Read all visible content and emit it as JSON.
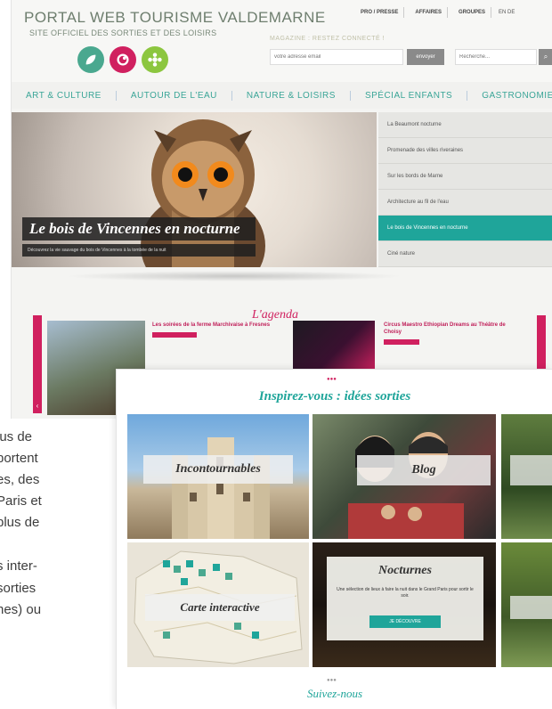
{
  "site": {
    "logo_title": "PORTAL WEB TOURISME VALDEMARNE",
    "logo_subtitle": "SITE OFFICIEL DES SORTIES ET DES LOISIRS",
    "top_links": [
      "PRO / PRESSE",
      "AFFAIRES",
      "GROUPES"
    ],
    "lang": "EN  DE",
    "magazine_label": "MAGAZINE : RESTEZ CONNECTÉ !",
    "email_placeholder": "votre adresse email",
    "email_button": "envoyer",
    "search_placeholder": "Recherche...",
    "search_icon": "search-icon",
    "nav": [
      "ART & CULTURE",
      "AUTOUR DE L'EAU",
      "NATURE & LOISIRS",
      "SPÉCIAL ENFANTS",
      "GASTRONOMIE"
    ],
    "hero_caption": "Le bois de Vincennes en nocturne",
    "hero_sub": "Découvrez la vie sauvage du bois de Vincennes à la tombée de la nuit",
    "hero_menu": [
      "La Beaumont nocturne",
      "Promenade des villes riveraines",
      "Sur les bords de Marne",
      "Architecture au fil de l'eau",
      "Le bois de Vincennes en nocturne",
      "Ciné nature"
    ],
    "hero_menu_active_index": 4,
    "agenda_title": "L'agenda",
    "agenda_items": [
      "Les soirées de la ferme Marchivaise à Fresnes",
      "Circus Maestro Ethiopian Dreams au Théâtre de Choisy"
    ],
    "colors": {
      "teal": "#1fa59a",
      "pink": "#d0205f",
      "logo_green": "#4aa88f"
    }
  },
  "panel": {
    "title": "Inspirez-vous : idées sorties",
    "tiles": [
      {
        "label": "Incontournables"
      },
      {
        "label": "Blog"
      },
      {
        "label": "Carte interactive"
      },
      {
        "label": "Nocturnes",
        "desc": "Une sélection de lieux à faire la nuit dans le Grand Paris pour sortir le soir.",
        "button": "JE DÉCOUVRE"
      }
    ],
    "follow": "Suivez-nous"
  },
  "article_lines": [
    "lus de",
    "portent",
    "es, des",
    "Paris et",
    "plus de",
    "s inter-",
    "sorties",
    "nes) ou"
  ]
}
